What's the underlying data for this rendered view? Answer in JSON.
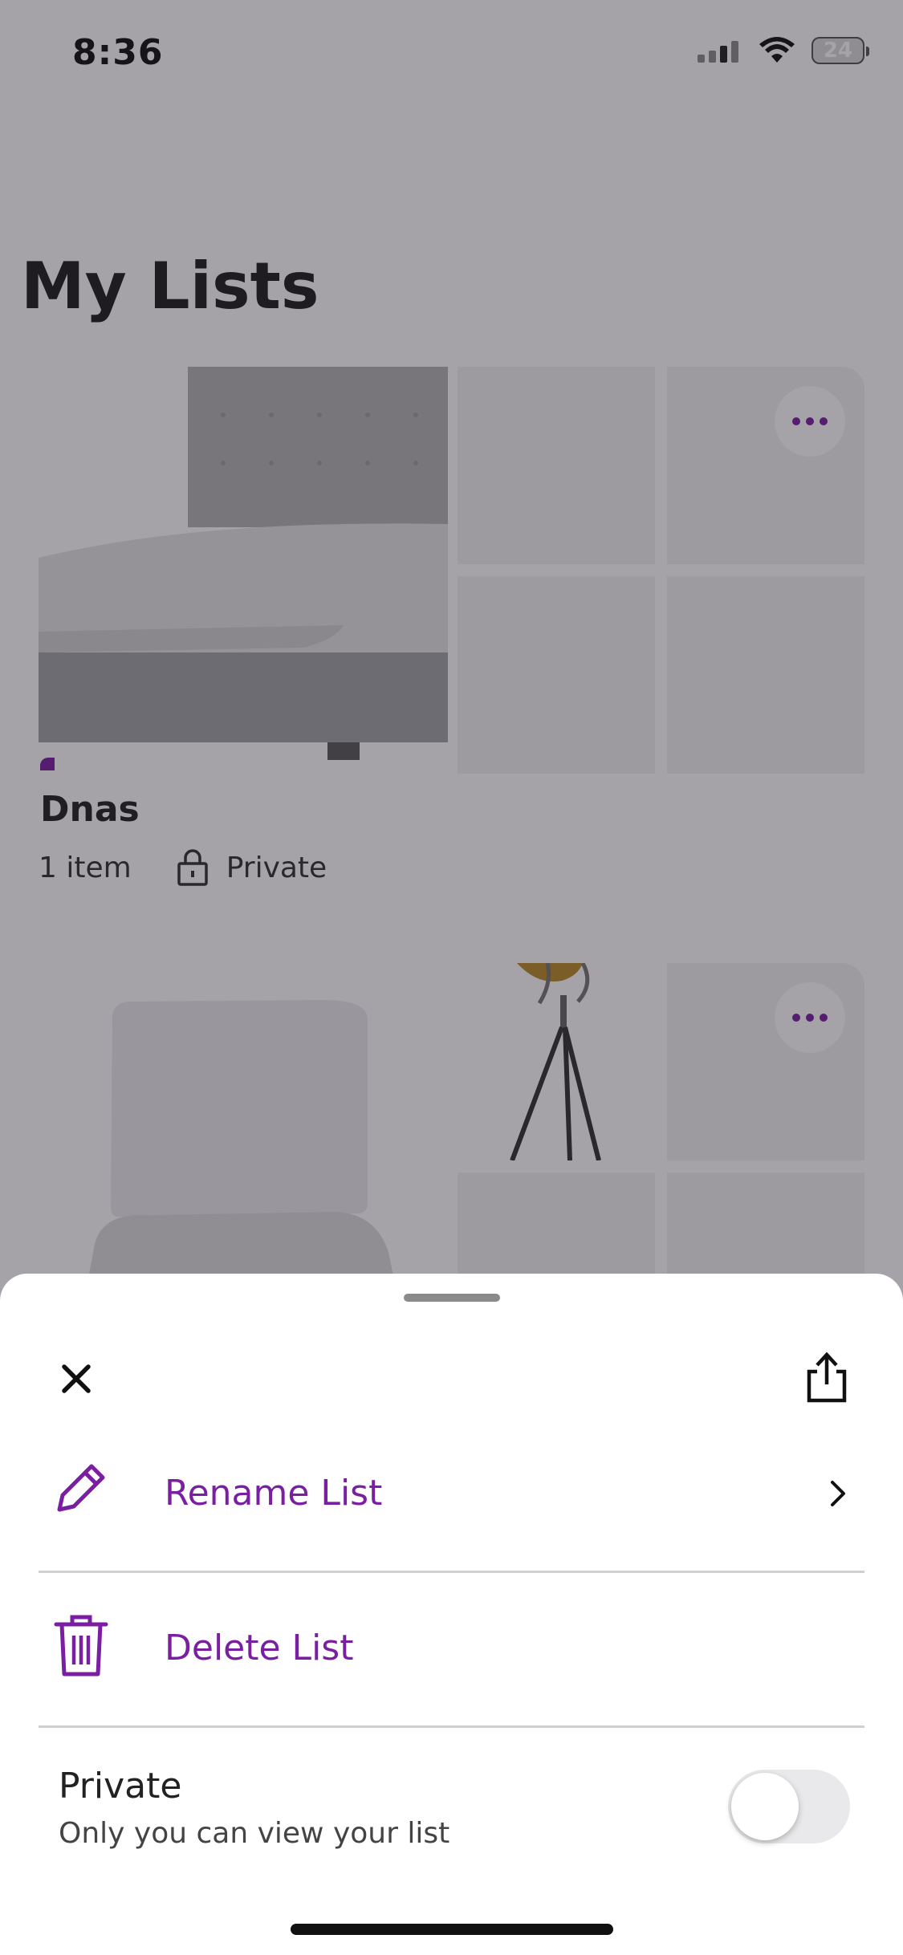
{
  "status_bar": {
    "time": "8:36",
    "battery": "24"
  },
  "page": {
    "title": "My Lists"
  },
  "lists": [
    {
      "name": "Dnas",
      "count": "1 item",
      "privacy": "Private"
    }
  ],
  "sheet": {
    "rename_label": "Rename List",
    "delete_label": "Delete List",
    "private_title": "Private",
    "private_subtitle": "Only you can view your list",
    "private_toggle_on": false
  },
  "colors": {
    "accent": "#7b1fa2",
    "overlay": "rgba(30,24,36,0.40)"
  }
}
